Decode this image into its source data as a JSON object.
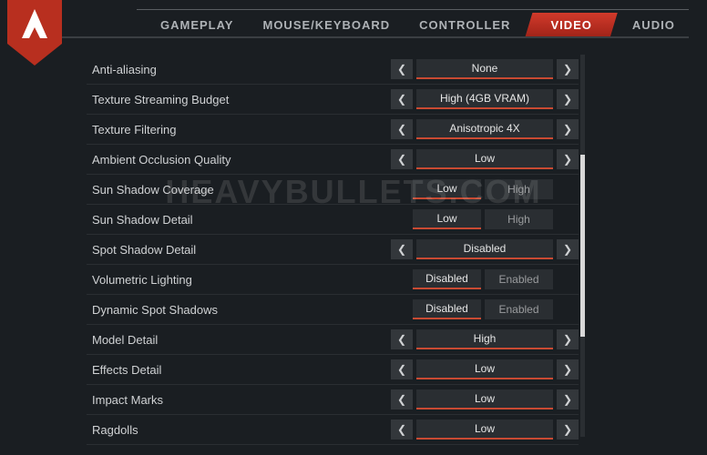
{
  "tabs": {
    "gameplay": "GAMEPLAY",
    "mousekb": "MOUSE/KEYBOARD",
    "controller": "CONTROLLER",
    "video": "VIDEO",
    "audio": "AUDIO"
  },
  "settings": {
    "antialiasing": {
      "label": "Anti-aliasing",
      "value": "None"
    },
    "texstream": {
      "label": "Texture Streaming Budget",
      "value": "High (4GB VRAM)"
    },
    "texfilter": {
      "label": "Texture Filtering",
      "value": "Anisotropic 4X"
    },
    "ao": {
      "label": "Ambient Occlusion Quality",
      "value": "Low"
    },
    "sunshadowcov": {
      "label": "Sun Shadow Coverage",
      "opt_a": "Low",
      "opt_b": "High"
    },
    "sunshadowdet": {
      "label": "Sun Shadow Detail",
      "opt_a": "Low",
      "opt_b": "High"
    },
    "spotshadow": {
      "label": "Spot Shadow Detail",
      "value": "Disabled"
    },
    "volumetric": {
      "label": "Volumetric Lighting",
      "opt_a": "Disabled",
      "opt_b": "Enabled"
    },
    "dynspot": {
      "label": "Dynamic Spot Shadows",
      "opt_a": "Disabled",
      "opt_b": "Enabled"
    },
    "modeldet": {
      "label": "Model Detail",
      "value": "High"
    },
    "effectsdet": {
      "label": "Effects Detail",
      "value": "Low"
    },
    "impactmarks": {
      "label": "Impact Marks",
      "value": "Low"
    },
    "ragdolls": {
      "label": "Ragdolls",
      "value": "Low"
    }
  },
  "watermark": "HEAVYBULLETS.COM"
}
